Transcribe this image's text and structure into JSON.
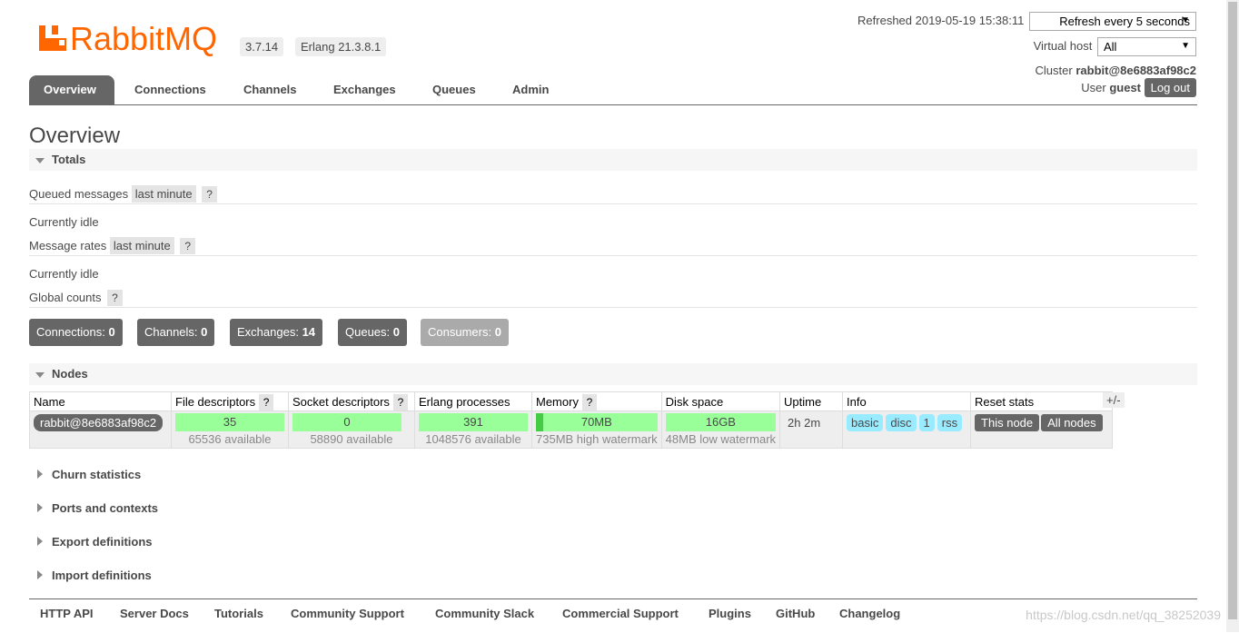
{
  "header": {
    "logo_text": "RabbitMQ",
    "version": "3.7.14",
    "erlang": "Erlang 21.3.8.1",
    "refreshed_label": "Refreshed 2019-05-19 15:38:11",
    "refresh_select": "Refresh every 5 seconds",
    "virtual_host_label": "Virtual host",
    "virtual_host_value": "All",
    "cluster_label": "Cluster",
    "cluster_name": "rabbit@8e6883af98c2",
    "user_label": "User",
    "user_name": "guest",
    "logout": "Log out"
  },
  "tabs": [
    "Overview",
    "Connections",
    "Channels",
    "Exchanges",
    "Queues",
    "Admin"
  ],
  "page_title": "Overview",
  "totals": {
    "heading": "Totals",
    "queued_messages": "Queued messages",
    "queued_range": "last minute",
    "help": "?",
    "idle1": "Currently idle",
    "message_rates": "Message rates",
    "rates_range": "last minute",
    "idle2": "Currently idle",
    "global_counts": "Global counts"
  },
  "counts": [
    {
      "label": "Connections:",
      "value": "0"
    },
    {
      "label": "Channels:",
      "value": "0"
    },
    {
      "label": "Exchanges:",
      "value": "14"
    },
    {
      "label": "Queues:",
      "value": "0"
    },
    {
      "label": "Consumers:",
      "value": "0"
    }
  ],
  "nodes": {
    "heading": "Nodes",
    "columns": [
      "Name",
      "File descriptors",
      "Socket descriptors",
      "Erlang processes",
      "Memory",
      "Disk space",
      "Uptime",
      "Info",
      "Reset stats"
    ],
    "plus_minus": "+/-",
    "row": {
      "name": "rabbit@8e6883af98c2",
      "file_descriptors": "35",
      "file_descriptors_sub": "65536 available",
      "socket_descriptors": "0",
      "socket_descriptors_sub": "58890 available",
      "erlang_processes": "391",
      "erlang_processes_sub": "1048576 available",
      "memory": "70MB",
      "memory_sub": "735MB high watermark",
      "disk": "16GB",
      "disk_sub": "48MB low watermark",
      "uptime": "2h 2m",
      "info": [
        "basic",
        "disc",
        "1",
        "rss"
      ],
      "reset_this": "This node",
      "reset_all": "All nodes"
    }
  },
  "collapsed_sections": [
    "Churn statistics",
    "Ports and contexts",
    "Export definitions",
    "Import definitions"
  ],
  "footer": [
    "HTTP API",
    "Server Docs",
    "Tutorials",
    "Community Support",
    "Community Slack",
    "Commercial Support",
    "Plugins",
    "GitHub",
    "Changelog"
  ],
  "watermark": "https://blog.csdn.net/qq_38252039",
  "colors": {
    "brand": "#f60",
    "accent": "#666666",
    "bar_ok": "#99ff99",
    "info": "#99ebff"
  }
}
